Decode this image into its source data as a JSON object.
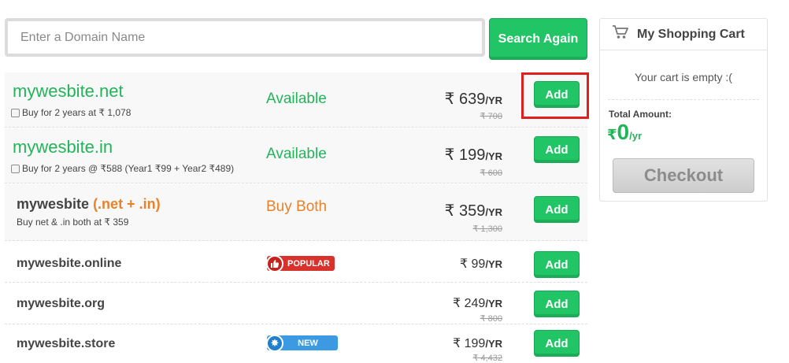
{
  "search": {
    "placeholder": "Enter a Domain Name",
    "button_label": "Search Again"
  },
  "results": [
    {
      "domain": "mywesbite.net",
      "option": "Buy for 2 years at ₹ 1,078",
      "status": "Available",
      "price": "₹ 639",
      "per": "/YR",
      "original_price": "₹ 700",
      "add_label": "Add"
    },
    {
      "domain": "mywesbite.in",
      "option": "Buy for 2 years @ ₹588 (Year1 ₹99 + Year2 ₹489)",
      "status": "Available",
      "price": "₹ 199",
      "per": "/YR",
      "original_price": "₹ 600",
      "add_label": "Add"
    },
    {
      "domain": "mywesbite",
      "combo": "(.net + .in)",
      "option": "Buy net & .in both at ₹ 359",
      "status": "Buy Both",
      "price": "₹ 359",
      "per": "/YR",
      "original_price": "₹ 1,300",
      "add_label": "Add"
    },
    {
      "domain": "mywesbite.online",
      "badge": "POPULAR",
      "price": "₹ 99",
      "per": "/YR",
      "add_label": "Add"
    },
    {
      "domain": "mywesbite.org",
      "price": "₹ 249",
      "per": "/YR",
      "original_price": "₹ 800",
      "add_label": "Add"
    },
    {
      "domain": "mywesbite.store",
      "badge": "NEW",
      "price": "₹ 199",
      "per": "/YR",
      "original_price": "₹ 4,432",
      "add_label": "Add"
    }
  ],
  "cart": {
    "title": "My Shopping Cart",
    "empty_message": "Your cart is empty :(",
    "total_label": "Total Amount:",
    "currency": "₹",
    "total_amount": "0",
    "total_per": "/yr",
    "checkout_label": "Checkout"
  },
  "colors": {
    "accent_green": "#22c565",
    "available_green": "#23b45a",
    "combo_orange": "#e8822a",
    "popular_red": "#d8322d",
    "new_blue": "#3b9ae1",
    "highlight_red": "#e01e1e"
  },
  "icons": {
    "cart": "shopping-cart-icon",
    "popular": "thumbs-up-icon",
    "new": "sparkle-badge-icon"
  }
}
